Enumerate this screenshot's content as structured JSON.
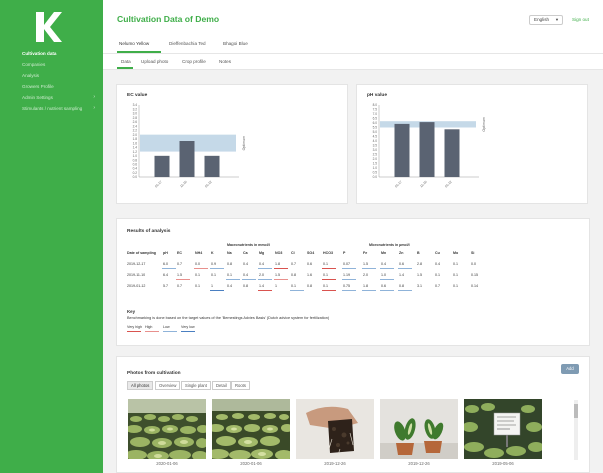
{
  "sidebar": {
    "items": [
      {
        "label": "Cultivation data",
        "active": true
      },
      {
        "label": "Companies",
        "active": false
      },
      {
        "label": "Analysis",
        "active": false
      },
      {
        "label": "Growers Profile",
        "active": false
      },
      {
        "label": "Admin Settings",
        "active": false
      },
      {
        "label": "Stimulants / nutrient sampling",
        "active": false
      }
    ]
  },
  "header": {
    "title": "Cultivation Data of Demo",
    "language": "English",
    "signout": "Sign out"
  },
  "crop_tabs": [
    "Nelumo Yellow",
    "Dieffenbachia Ted",
    "Bhagoi Blue"
  ],
  "sub_tabs": [
    "Data",
    "Upload photo",
    "Crop profile",
    "Notes"
  ],
  "ec_chart": {
    "card_title": "EC value",
    "side_label": "Optimum",
    "chart_data": {
      "type": "bar",
      "categories": [
        "01-17",
        "11-10",
        "01-12"
      ],
      "values": [
        1.0,
        1.7,
        1.0
      ],
      "ylim": [
        0,
        3.4
      ],
      "optimum_band": [
        1.2,
        2.0
      ],
      "yticks": [
        "3.4",
        "3.2",
        "3.0",
        "2.8",
        "2.6",
        "2.4",
        "2.2",
        "2.0",
        "1.8",
        "1.6",
        "1.4",
        "1.2",
        "1.0",
        "0.8",
        "0.6",
        "0.4",
        "0.2",
        "0.0"
      ],
      "bar_color": "#5a6372",
      "band_color": "#c5d9e8"
    }
  },
  "ph_chart": {
    "card_title": "pH value",
    "side_label": "Optimum",
    "chart_data": {
      "type": "bar",
      "categories": [
        "01-17",
        "11-10",
        "01-12"
      ],
      "values": [
        5.9,
        6.1,
        5.3
      ],
      "ylim": [
        0,
        8.0
      ],
      "optimum_band": [
        5.5,
        6.2
      ],
      "yticks": [
        "8.0",
        "7.5",
        "7.0",
        "6.5",
        "6.0",
        "5.5",
        "5.0",
        "4.5",
        "4.0",
        "3.5",
        "3.0",
        "2.5",
        "2.0",
        "1.5",
        "1.0",
        "0.5",
        "0.0"
      ],
      "bar_color": "#5a6372",
      "band_color": "#c5d9e8"
    }
  },
  "analysis": {
    "title": "Results of analysis",
    "macro_header": "Macronutrients in mmol/l",
    "micro_header": "Micronutrients in µmol/l",
    "columns": [
      "Date of sampling",
      "pH",
      "EC",
      "NH4",
      "K",
      "Na",
      "Ca",
      "Mg",
      "NO3",
      "Cl",
      "SO4",
      "HCO3",
      "P",
      "Fe",
      "Mn",
      "Zn",
      "B",
      "Cu",
      "Mo",
      "Si"
    ],
    "rows": [
      [
        "2019-12-17",
        "6.0",
        "0.7",
        "0.0",
        "0.9",
        "0.8",
        "0.4",
        "0.4",
        "1.8",
        "0.7",
        "0.6",
        "0.1",
        "0.07",
        "1.5",
        "0.4",
        "0.6",
        "2.8",
        "0.4",
        "0.1",
        "0.0"
      ],
      [
        "2019-11-10",
        "6.4",
        "1.5",
        "0.1",
        "0.1",
        "0.1",
        "0.4",
        "2.0",
        "1.5",
        "0.8",
        "1.6",
        "0.1",
        "1.19",
        "2.0",
        "1.0",
        "1.4",
        "1.5",
        "0.1",
        "0.1",
        "0.15"
      ],
      [
        "2019-01-12",
        "5.7",
        "0.7",
        "0.1",
        "1",
        "0.4",
        "0.8",
        "1.4",
        "1",
        "0.1",
        "0.8",
        "0.1",
        "0.75",
        "1.8",
        "0.6",
        "0.8",
        "3.1",
        "0.7",
        "0.1",
        "0.14"
      ]
    ],
    "key_title": "Key",
    "key_note": "Benchmarking is done based on the target values of the 'Bemestings Advies Basis' (Dutch advice system for fertilization)",
    "legend": [
      {
        "label": "Very high",
        "color": "#d9534f"
      },
      {
        "label": "High",
        "color": "#e8908d"
      },
      {
        "label": "Low",
        "color": "#8fb3d9"
      },
      {
        "label": "Very low",
        "color": "#4a7fc1"
      }
    ]
  },
  "photos": {
    "title": "Photos from cultivation",
    "add_label": "Add",
    "filters": [
      "All photos",
      "Overview",
      "Single plant",
      "Detail",
      "Roots"
    ],
    "items": [
      {
        "date": "2020-01-06",
        "kind": "field-plants"
      },
      {
        "date": "2020-01-06",
        "kind": "field-plants"
      },
      {
        "date": "2019-12-26",
        "kind": "soil-hand"
      },
      {
        "date": "2019-12-26",
        "kind": "potted-plants"
      },
      {
        "date": "2019-05-06",
        "kind": "field-sign"
      }
    ]
  },
  "colors": {
    "brand_green": "#3fae49",
    "bar": "#5a6372",
    "band": "#c5d9e8"
  }
}
